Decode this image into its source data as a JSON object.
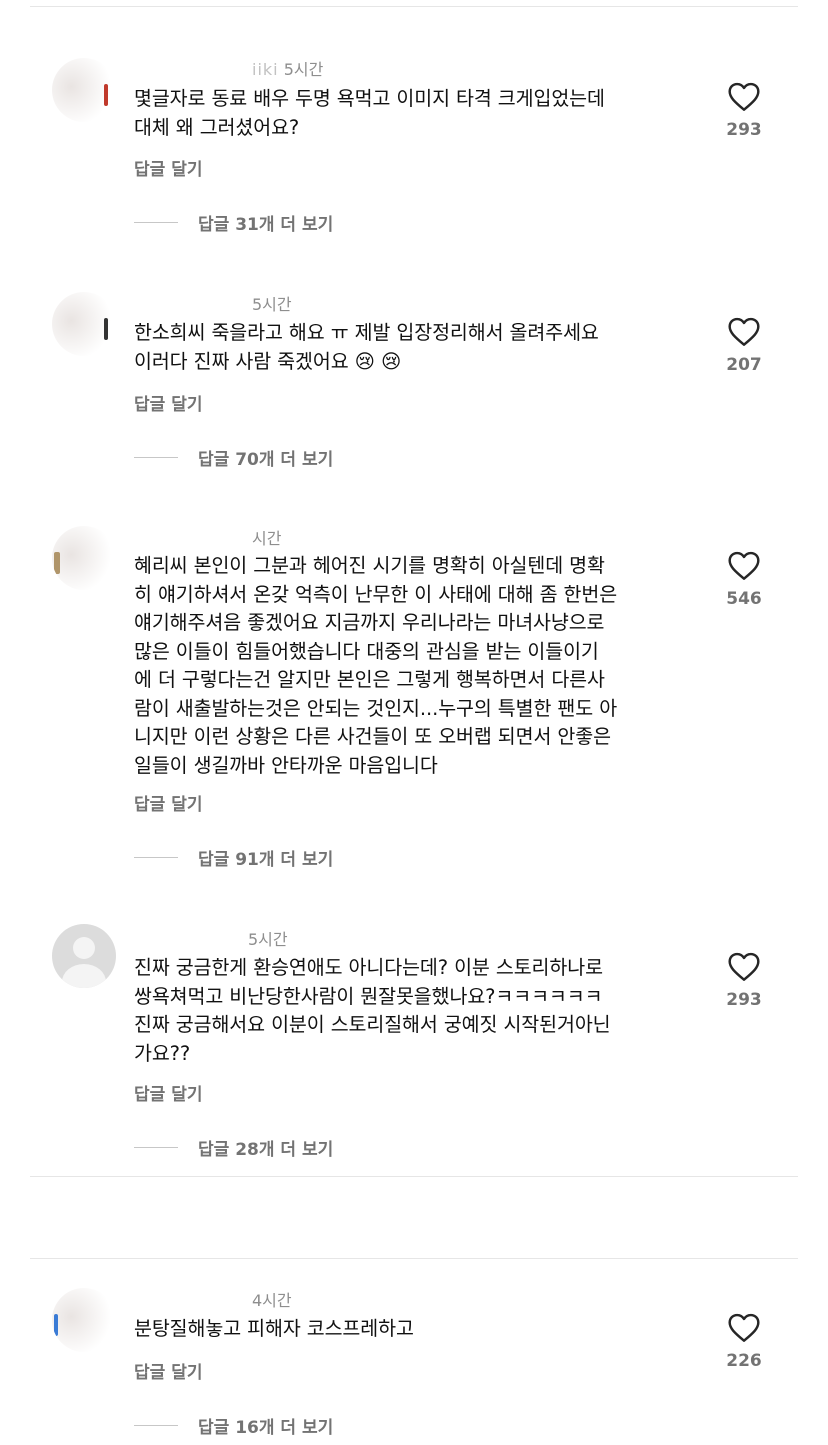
{
  "comments": [
    {
      "username": "iiki",
      "time": "5시간",
      "text_lines": [
        "몇글자로 동료 배우 두명 욕먹고 이미지 타격 크게입었는데",
        "대체 왜 그러셨어요?"
      ],
      "reply_label": "답글 달기",
      "view_replies": "답글 31개 더 보기",
      "likes": "293",
      "avatar_accent": "#c0392b"
    },
    {
      "username": "",
      "time": "5시간",
      "text_lines": [
        "한소희씨 죽을라고 해요 ㅠ 제발 입장정리해서 올려주세요",
        "이러다 진짜 사람 죽겠어요 😢 😢"
      ],
      "reply_label": "답글 달기",
      "view_replies": "답글 70개 더 보기",
      "likes": "207",
      "avatar_accent": "#333333"
    },
    {
      "username": "",
      "time": "시간",
      "text_lines": [
        "혜리씨 본인이 그분과 헤어진 시기를 명확히 아실텐데 명확",
        "히 얘기하셔서 온갖 억측이 난무한 이 사태에 대해 좀 한번은",
        "얘기해주셔음 좋겠어요  지금까지 우리나라는 마녀사냥으로",
        "많은 이들이 힘들어했습니다  대중의 관심을 받는 이들이기",
        "에 더 구렇다는건 알지만 본인은 그렇게 행복하면서 다른사",
        "람이 새출발하는것은 안되는 것인지...누구의 특별한 팬도 아",
        "니지만 이런 상황은 다른 사건들이 또 오버랩 되면서 안좋은",
        "일들이 생길까바 안타까운 마음입니다"
      ],
      "reply_label": "답글 달기",
      "view_replies": "답글 91개 더 보기",
      "likes": "546",
      "avatar_accent": "#b0956a"
    },
    {
      "username": "",
      "time": "5시간",
      "text_lines": [
        "진짜 궁금한게 환승연애도 아니다는데? 이분 스토리하나로",
        "쌍욕쳐먹고 비난당한사람이 뭔잘못을했나요?ㅋㅋㅋㅋㅋㅋ",
        "진짜 궁금해서요 이분이 스토리질해서 궁예짓 시작된거아닌",
        "가요??"
      ],
      "reply_label": "답글 달기",
      "view_replies": "답글 28개 더 보기",
      "likes": "293",
      "avatar_accent": "#dcdcdc"
    },
    {
      "username": "",
      "time": "4시간",
      "text_lines": [
        "분탕질해놓고 피해자 코스프레하고"
      ],
      "reply_label": "답글 달기",
      "view_replies": "답글 16개 더 보기",
      "likes": "226",
      "avatar_accent": "#3a7bd5"
    }
  ],
  "colors": {
    "text": "#111111",
    "secondary": "#737373",
    "divider": "#e6e6e6"
  },
  "icons": {
    "like": "heart-outline-icon",
    "default_avatar": "default-avatar-icon"
  }
}
